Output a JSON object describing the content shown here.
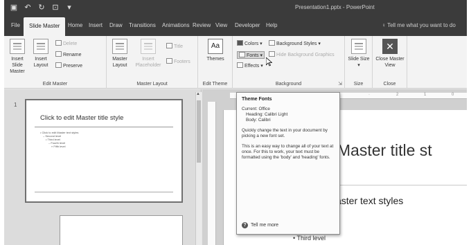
{
  "window": {
    "title": "Presentation1.pptx - PowerPoint",
    "qat_icons": [
      "save-icon",
      "undo-icon",
      "redo-icon",
      "present-icon",
      "customize-icon"
    ],
    "qat_glyphs": [
      "▣",
      "↶",
      "↻",
      "⊡",
      "▾"
    ]
  },
  "tabs": [
    {
      "label": "File"
    },
    {
      "label": "Slide Master",
      "active": true
    },
    {
      "label": "Home"
    },
    {
      "label": "Insert"
    },
    {
      "label": "Draw"
    },
    {
      "label": "Transitions"
    },
    {
      "label": "Animations"
    },
    {
      "label": "Review"
    },
    {
      "label": "View"
    },
    {
      "label": "Developer"
    },
    {
      "label": "Help"
    }
  ],
  "tell_me": "Tell me what you want to do",
  "ribbon": {
    "edit_master": {
      "label": "Edit Master",
      "insert_slide_master": "Insert Slide Master",
      "insert_layout": "Insert Layout",
      "delete": "Delete",
      "rename": "Rename",
      "preserve": "Preserve"
    },
    "master_layout": {
      "label": "Master Layout",
      "master_layout_btn": "Master Layout",
      "insert_placeholder": "Insert Placeholder",
      "title": "Title",
      "footers": "Footers"
    },
    "edit_theme": {
      "label": "Edit Theme",
      "themes": "Themes"
    },
    "background": {
      "label": "Background",
      "colors": "Colors",
      "fonts": "Fonts",
      "effects": "Effects",
      "background_styles": "Background Styles",
      "hide_bg": "Hide Background Graphics"
    },
    "size": {
      "label": "Size",
      "slide_size": "Slide Size"
    },
    "close": {
      "label": "Close",
      "close_master_view": "Close Master View"
    }
  },
  "thumbnails": {
    "slide_number": "1",
    "master_title": "Click to edit Master title style",
    "master_body_lines": [
      "• Click to edit Master text styles",
      "– Second level",
      "• Third level",
      "– Fourth level",
      "» Fifth level"
    ]
  },
  "slide": {
    "title": "it Master title st",
    "body": "aster text styles",
    "third": "• Third level"
  },
  "tooltip": {
    "title": "Theme Fonts",
    "current_label": "Current: Office",
    "heading": "Heading: Calibri Light",
    "body": "Body: Calibri",
    "desc1": "Quickly change the text in your document by picking a new font set.",
    "desc2": "This is an easy way to change all of your text at once. For this to work, your text must be formatted using the 'body' and 'heading' fonts.",
    "help": "Tell me more"
  }
}
